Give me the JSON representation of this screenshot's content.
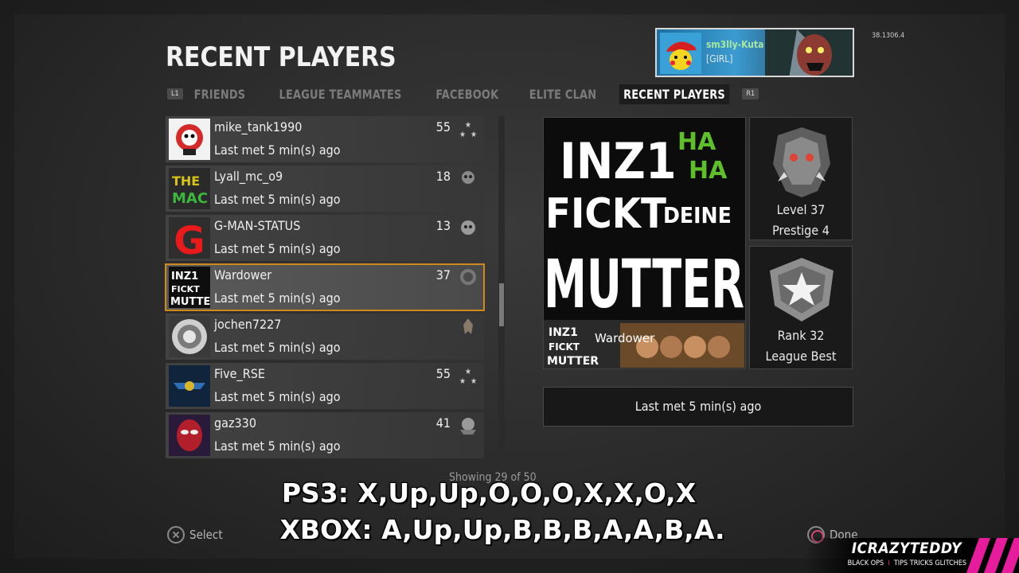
{
  "version": "38.1306.4",
  "page_title": "RECENT PLAYERS",
  "player_card": {
    "gamertag": "sm3lly-Kuta",
    "clan": "[GIRL]"
  },
  "tabs": {
    "left_bumper": "L1",
    "right_bumper": "R1",
    "items": [
      "FRIENDS",
      "LEAGUE TEAMMATES",
      "FACEBOOK",
      "ELITE CLAN",
      "RECENT PLAYERS"
    ],
    "active": "RECENT PLAYERS"
  },
  "players": [
    {
      "name": "mike_tank1990",
      "level": "55",
      "met": "Last met 5 min(s) ago"
    },
    {
      "name": "Lyall_mc_o9",
      "level": "18",
      "met": "Last met 5 min(s) ago"
    },
    {
      "name": "G-MAN-STATUS",
      "level": "13",
      "met": "Last met 5 min(s) ago"
    },
    {
      "name": "Wardower",
      "level": "37",
      "met": "Last met 5 min(s) ago"
    },
    {
      "name": "jochen7227",
      "level": "",
      "met": "Last met 5 min(s) ago"
    },
    {
      "name": "Five_RSE",
      "level": "55",
      "met": "Last met 5 min(s) ago"
    },
    {
      "name": "gaz330",
      "level": "41",
      "met": "Last met 5 min(s) ago"
    }
  ],
  "detail": {
    "emblem_text": {
      "l1": "INZ1",
      "ha1": "HA",
      "ha2": "HA",
      "l2": "FICKT",
      "deine": "DEINE",
      "l3": "MUTTER"
    },
    "calling_card_name": "Wardower",
    "level": "Level 37",
    "prestige": "Prestige 4",
    "rank": "Rank 32",
    "league": "League Best",
    "last_met": "Last met 5 min(s) ago"
  },
  "showing": "Showing 29 of 50",
  "footer": {
    "select": "Select",
    "done": "Done"
  },
  "overlay": {
    "ps3": "PS3: X,Up,Up,O,O,O,X,X,O,X",
    "xbox": "XBOX: A,Up,Up,B,B,B,A,A,B,A."
  },
  "watermark": {
    "brand": "ICRAZYTEDDY",
    "tag1": "BLACK OPS",
    "tag2": "TIPS TRICKS GLITCHES"
  },
  "colors": {
    "selected_outline": "#d08a1c",
    "accent_pink": "#e61c9c",
    "ha_green": "#5fbf2a"
  }
}
